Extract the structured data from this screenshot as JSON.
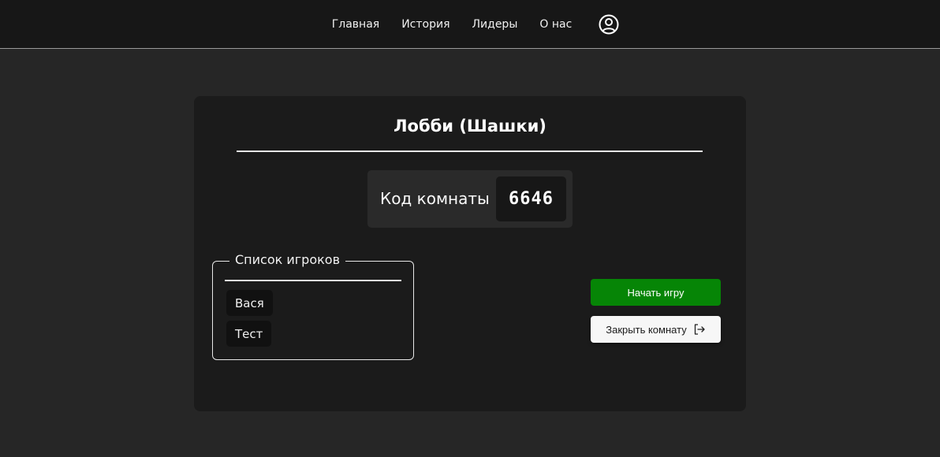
{
  "nav": {
    "items": [
      {
        "label": "Главная"
      },
      {
        "label": "История"
      },
      {
        "label": "Лидеры"
      },
      {
        "label": "О нас"
      }
    ],
    "profile_icon": "user-circle-icon"
  },
  "lobby": {
    "title": "Лобби (Шашки)",
    "room_code_label": "Код комнаты",
    "room_code": "6646",
    "players_legend": "Список игроков",
    "players": [
      "Вася",
      "Тест"
    ],
    "start_button": "Начать игру",
    "close_button": "Закрыть комнату",
    "close_icon": "logout-icon"
  },
  "colors": {
    "background": "#262626",
    "topbar": "#171717",
    "card": "#1b1b1b",
    "start_button": "#068506",
    "close_button": "#f7f7f7"
  }
}
